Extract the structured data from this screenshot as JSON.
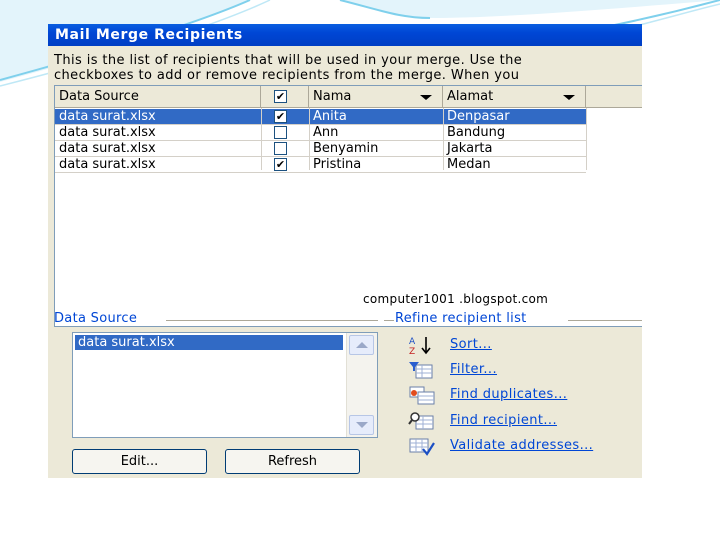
{
  "dialog": {
    "title": "Mail Merge Recipients",
    "intro_line1": "This is the list of recipients that will be used in your merge.  Use the",
    "intro_line2": "checkboxes to add or remove recipients from the merge.  When you"
  },
  "grid": {
    "headers": {
      "data_source": "Data Source",
      "nama": "Nama",
      "alamat": "Alamat"
    },
    "rows": [
      {
        "source": "data surat.xlsx",
        "checked": true,
        "nama": "Anita",
        "alamat": "Denpasar",
        "selected": true
      },
      {
        "source": "data surat.xlsx",
        "checked": false,
        "nama": "Ann",
        "alamat": "Bandung",
        "selected": false
      },
      {
        "source": "data surat.xlsx",
        "checked": false,
        "nama": "Benyamin",
        "alamat": "Jakarta",
        "selected": false
      },
      {
        "source": "data surat.xlsx",
        "checked": true,
        "nama": "Pristina",
        "alamat": "Medan",
        "selected": false
      }
    ],
    "watermark": "computer1001 .blogspot.com"
  },
  "data_source_section": {
    "label": "Data Source",
    "items": [
      "data surat.xlsx"
    ],
    "edit_button": "Edit...",
    "refresh_button": "Refresh"
  },
  "refine_section": {
    "label": "Refine recipient list",
    "items": [
      {
        "label": "Sort...",
        "icon": "sort-az-icon"
      },
      {
        "label": "Filter...",
        "icon": "filter-icon"
      },
      {
        "label": "Find duplicates...",
        "icon": "find-duplicates-icon"
      },
      {
        "label": "Find recipient...",
        "icon": "find-recipient-icon"
      },
      {
        "label": "Validate addresses...",
        "icon": "validate-addresses-icon"
      }
    ]
  },
  "colors": {
    "titlebar": "#0046d5",
    "selection": "#316ac5",
    "link": "#0046d5",
    "dialog_bg": "#ece9d8"
  }
}
